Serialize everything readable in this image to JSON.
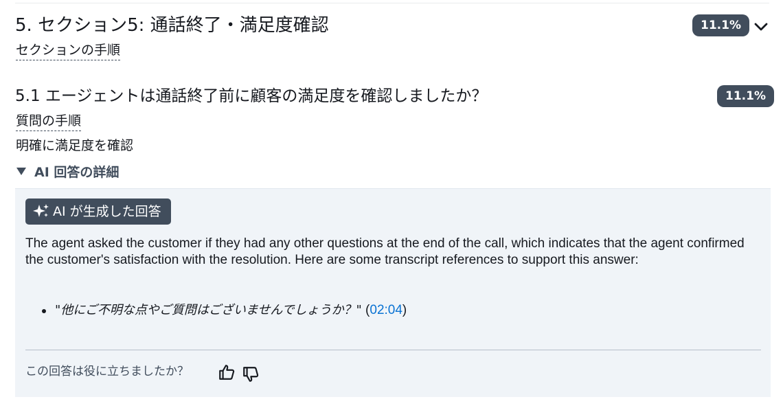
{
  "section": {
    "title": "5. セクション5: 通話終了・満足度確認",
    "steps_link": "セクションの手順",
    "score": "11.1%"
  },
  "question": {
    "title": "5.1 エージェントは通話終了前に顧客の満足度を確認しましたか？",
    "steps_link": "質問の手順",
    "instruction": "明確に満足度を確認",
    "score": "11.1%"
  },
  "ai_details": {
    "summary_label": "AI 回答の詳細",
    "chip_label": "AI が生成した回答",
    "answer_text": "The agent asked the customer if they had any other questions at the end of the call, which indicates that the agent confirmed the customer's satisfaction with the resolution. Here are some transcript references to support this answer:",
    "references": [
      {
        "quote": "\"他にご不明な点やご質問はございませんでしょうか？\"",
        "open_paren": " (",
        "timestamp": "02:04",
        "close_paren": ")"
      }
    ],
    "feedback_prompt": "この回答は役に立ちましたか？"
  },
  "icons": {
    "chevron": "chevron-down-icon",
    "sparkle": "sparkle-icon",
    "thumbs_up": "thumbs-up-icon",
    "thumbs_down": "thumbs-down-icon"
  },
  "colors": {
    "badge_bg": "#414d5c",
    "panel_bg": "#f0f4f8",
    "link": "#0972d3",
    "text": "#16191f"
  }
}
